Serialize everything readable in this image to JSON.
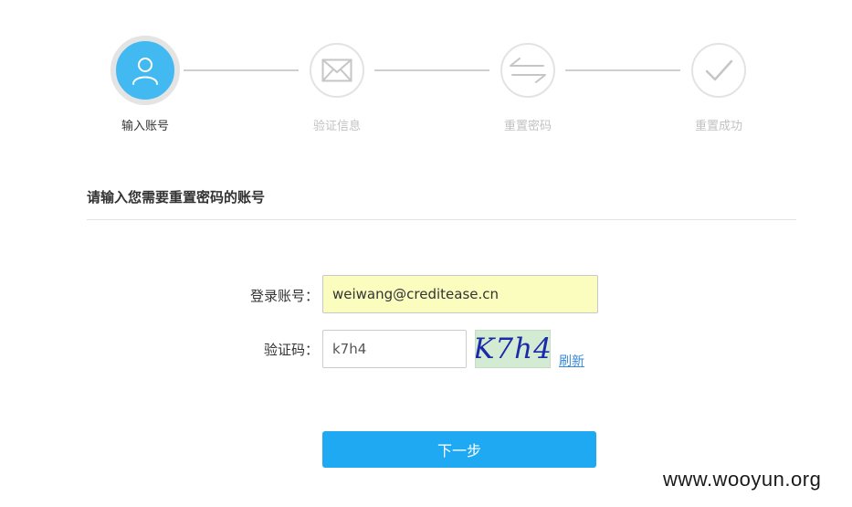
{
  "stepper": {
    "steps": [
      {
        "label": "输入账号",
        "icon": "user-icon",
        "state": "active"
      },
      {
        "label": "验证信息",
        "icon": "envelope-icon",
        "state": "inactive"
      },
      {
        "label": "重置密码",
        "icon": "swap-arrows-icon",
        "state": "inactive"
      },
      {
        "label": "重置成功",
        "icon": "checkmark-icon",
        "state": "inactive"
      }
    ]
  },
  "section": {
    "title": "请输入您需要重置密码的账号"
  },
  "form": {
    "account_label": "登录账号：",
    "account_value": "weiwang@creditease.cn",
    "captcha_label": "验证码：",
    "captcha_value": "k7h4",
    "captcha_image_text": "K7h4",
    "refresh_label": "刷新",
    "next_label": "下一步"
  },
  "watermark": "www.wooyun.org",
  "colors": {
    "accent": "#1fa9f2",
    "active_step": "#42b9f0",
    "autofill_bg": "#fafdbd",
    "inactive_text": "#c2c2c2"
  }
}
